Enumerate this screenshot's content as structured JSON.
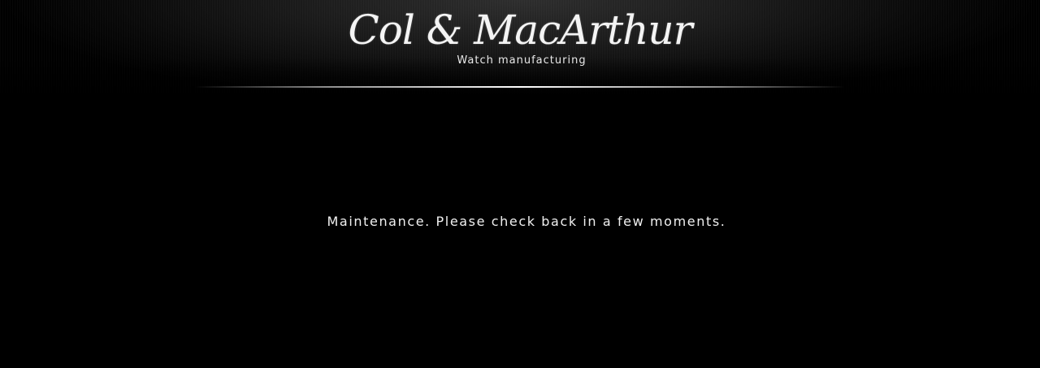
{
  "header": {
    "brand_name": "Col & MacArthur",
    "tagline": "Watch manufacturing"
  },
  "main": {
    "maintenance_message": "Maintenance. Please check back in a few moments."
  },
  "colors": {
    "background": "#000000",
    "text": "#f0f0f0"
  }
}
